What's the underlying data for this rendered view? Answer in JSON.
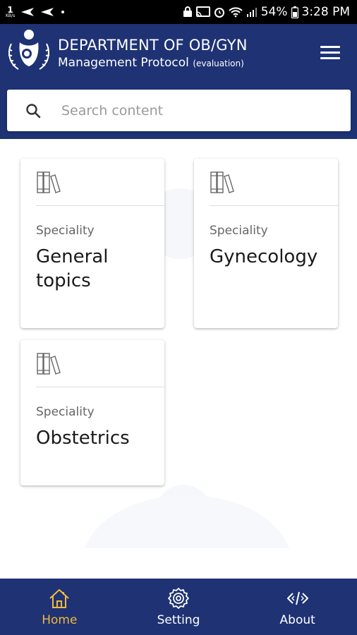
{
  "status_bar": {
    "speed_value": "1",
    "speed_unit": "KB/s",
    "battery": "54%",
    "time": "3:28 PM"
  },
  "header": {
    "title": "DEPARTMENT OF OB/GYN",
    "subtitle": "Management Protocol",
    "subtitle_tag": "(evaluation)",
    "menu_icon": "hamburger-menu-icon"
  },
  "search": {
    "placeholder": "Search content",
    "icon": "search-icon"
  },
  "cards": [
    {
      "kicker": "Speciality",
      "title": "General topics",
      "icon": "books-icon"
    },
    {
      "kicker": "Speciality",
      "title": "Gynecology",
      "icon": "books-icon"
    },
    {
      "kicker": "Speciality",
      "title": "Obstetrics",
      "icon": "books-icon"
    }
  ],
  "bottom_nav": [
    {
      "label": "Home",
      "icon": "home-icon",
      "active": true
    },
    {
      "label": "Setting",
      "icon": "gear-icon",
      "active": false
    },
    {
      "label": "About",
      "icon": "code-icon",
      "active": false
    }
  ],
  "colors": {
    "header_bg": "#1e3274",
    "active_nav": "#f2b93a",
    "status_bar_bg": "#000000"
  }
}
